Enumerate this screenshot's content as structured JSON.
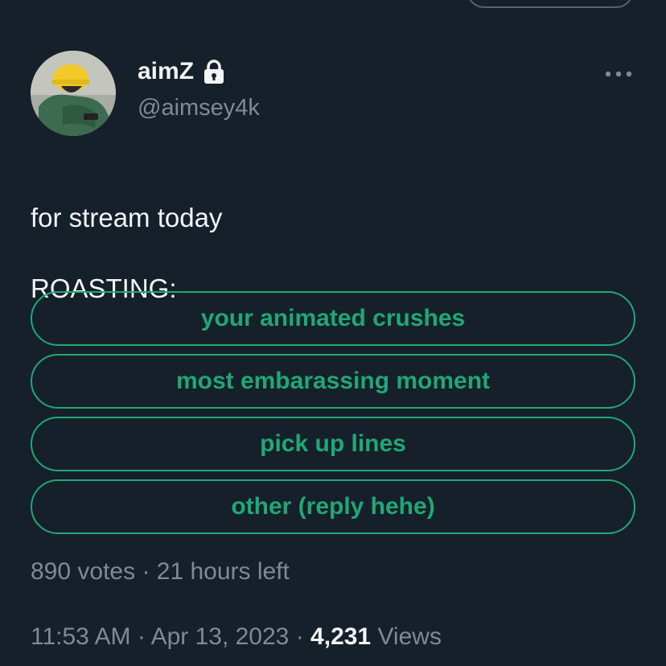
{
  "author": {
    "display_name": "aimZ",
    "handle": "@aimsey4k",
    "verified_icon": "lock-icon",
    "avatar_icon": "avatar-hardhat"
  },
  "menu_icon": "more-icon",
  "tweet": {
    "line1": "for stream today",
    "line2": "ROASTING:"
  },
  "poll": {
    "options": [
      "your animated crushes",
      "most embarassing moment",
      "pick up lines",
      "other (reply hehe)"
    ],
    "votes": "890 votes",
    "separator": "·",
    "time_left": "21 hours left"
  },
  "meta": {
    "time": "11:53 AM",
    "date": "Apr 13, 2023",
    "separator": "·",
    "views_count": "4,231",
    "views_label": "Views"
  },
  "colors": {
    "background": "#16202b",
    "accent": "#1fa776",
    "muted": "#7e8a96",
    "text": "#f2f4f5"
  }
}
